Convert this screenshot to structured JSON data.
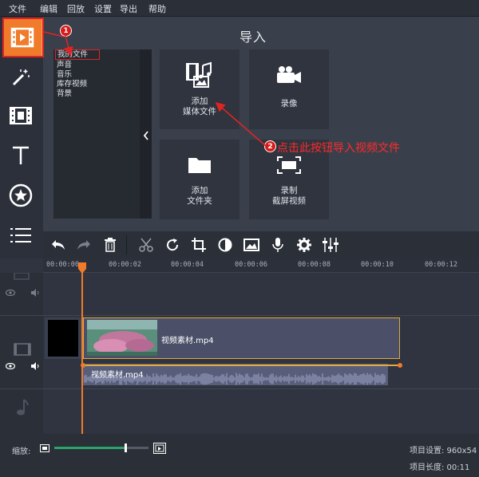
{
  "menu": [
    "文件",
    "编辑",
    "回放",
    "设置",
    "导出",
    "帮助"
  ],
  "page_title": "导入",
  "file_list": {
    "selected": "我的文件",
    "items": [
      "声音",
      "音乐",
      "库存视频",
      "背景"
    ]
  },
  "tiles": {
    "add_media": "添加\n媒体文件",
    "record_video": "录像",
    "add_folder": "添加\n文件夹",
    "screen_capture": "录制\n截屏视频"
  },
  "annotations": {
    "step1": "1",
    "step2": "2",
    "step2_text": "点击此按钮导入视频文件"
  },
  "timeline": {
    "ticks": [
      "00:00:00",
      "00:00:02",
      "00:00:04",
      "00:00:06",
      "00:00:08",
      "00:00:10",
      "00:00:12"
    ],
    "video_clip_name": "视频素材.mp4",
    "audio_clip_name": "视频素材.mp4"
  },
  "status": {
    "zoom_label": "缩放:",
    "zoom_level": 0.75,
    "project_settings": "项目设置:  960x54",
    "project_length": "项目长度:  00:11"
  },
  "colors": {
    "accent_orange": "#f07b2b",
    "annotation_red": "#d81b1b",
    "clip_border": "#e4a93a",
    "zoom_green": "#2aa36a"
  },
  "icons": {
    "import": "film-import-icon",
    "effects": "magic-wand-icon",
    "transitions": "film-frame-icon",
    "titles": "text-T-icon",
    "stickers": "star-badge-icon",
    "more": "list-icon"
  }
}
